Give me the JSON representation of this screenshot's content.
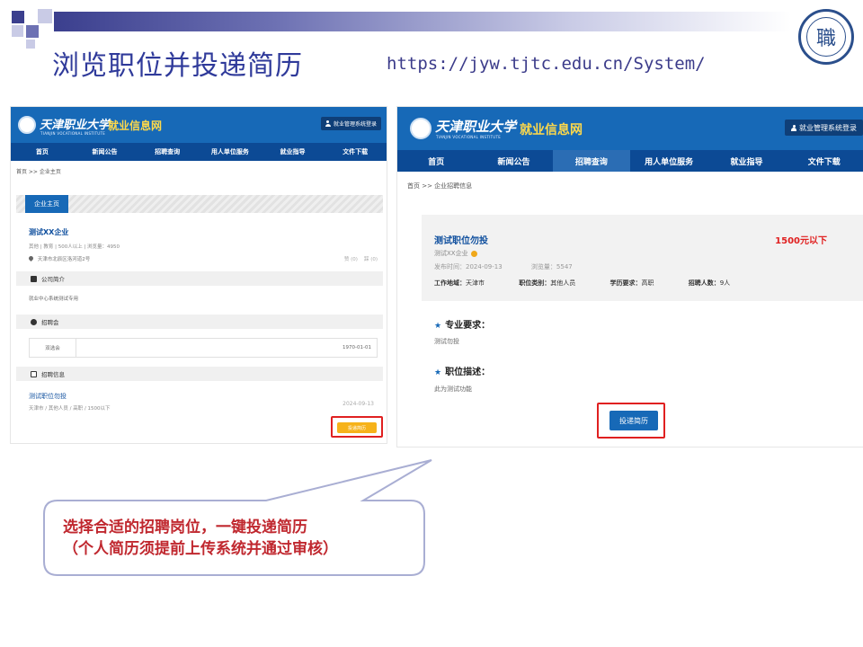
{
  "slide": {
    "title": "浏览职位并投递简历",
    "url": "https://jyw.tjtc.edu.cn/System/",
    "title_bar_color": "#3b3f8e",
    "seal_icon": "university-seal-icon"
  },
  "site": {
    "logo_cn": "天津职业大学",
    "logo_en": "TIANJIN VOCATIONAL INSTITUTE",
    "site_name": "就业信息网",
    "login_label": "就业管理系统登录",
    "brand_color": "#1769b7",
    "nav": [
      "首页",
      "新闻公告",
      "招聘查询",
      "用人单位服务",
      "就业指导",
      "文件下载"
    ]
  },
  "left": {
    "breadcrumb": "首页 >> 企业主页",
    "tab_label": "企业主页",
    "company_name": "测试XX企业",
    "company_meta": "其他 | 教育 | 500人以上 | 浏览量：4950",
    "address": "天津市北辰区洛河道2号",
    "likes": "赞 (0)",
    "dislikes": "踩 (0)",
    "intro_title": "公司简介",
    "intro_text": "就业中心系统测试专用",
    "fair_title": "招聘会",
    "fair_name": "双选会",
    "fair_date": "1970-01-01",
    "jobs_title": "招聘信息",
    "job_title": "测试职位勿投",
    "job_info": "天津市 / 其他人员 / 高职 / 1500以下",
    "job_date": "2024-09-13",
    "apply_label": "投递简历"
  },
  "right": {
    "breadcrumb": "首页 >> 企业招聘信息",
    "job_title": "测试职位勿投",
    "salary": "1500元以下",
    "company": "测试XX企业",
    "publish_time": "发布时间：2024-09-13",
    "views": "浏览量：5547",
    "location_label": "工作地域：",
    "location": "天津市",
    "category_label": "职位类别：",
    "category": "其他人员",
    "education_label": "学历要求：",
    "education": "高职",
    "headcount_label": "招聘人数：",
    "headcount": "9人",
    "requirement_title": "专业要求：",
    "requirement_text": "测试勿投",
    "description_title": "职位描述：",
    "description_text": "此为测试功能",
    "apply_label": "投递简历",
    "highlight_color": "#e02020"
  },
  "callout": {
    "line1": "选择合适的招聘岗位，一键投递简历",
    "line2": "（个人简历须提前上传系统并通过审核）",
    "text_color": "#c0282f"
  }
}
